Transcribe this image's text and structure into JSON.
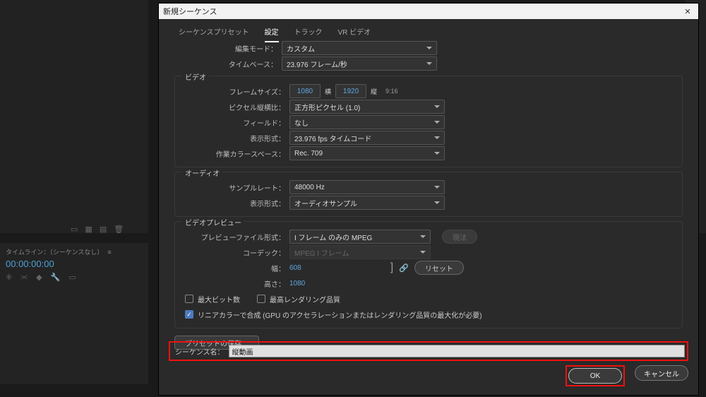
{
  "dialog": {
    "title": "新規シーケンス"
  },
  "tabs": {
    "preset": "シーケンスプリセット",
    "settings": "設定",
    "tracks": "トラック",
    "vr": "VR ビデオ"
  },
  "edit_mode": {
    "label": "編集モード：",
    "value": "カスタム"
  },
  "timebase": {
    "label": "タイムベース：",
    "value": "23.976 フレーム/秒"
  },
  "video": {
    "group": "ビデオ",
    "frame_size_label": "フレームサイズ：",
    "width": "1080",
    "w_unit": "横",
    "height": "1920",
    "h_unit": "縦",
    "ratio": "9:16",
    "pixel_aspect_label": "ピクセル縦横比：",
    "pixel_aspect": "正方形ピクセル (1.0)",
    "fields_label": "フィールド：",
    "fields": "なし",
    "display_label": "表示形式：",
    "display": "23.976 fps タイムコード",
    "color_label": "作業カラースペース：",
    "color": "Rec. 709"
  },
  "audio": {
    "group": "オーディオ",
    "rate_label": "サンプルレート：",
    "rate": "48000 Hz",
    "display_label": "表示形式：",
    "display": "オーディオサンプル"
  },
  "preview": {
    "group": "ビデオプレビュー",
    "file_label": "プレビューファイル形式：",
    "file": "I フレーム のみの MPEG",
    "build_btn": "現法",
    "codec_label": "コーデック：",
    "codec": "MPEG I フレーム",
    "width_label": "幅：",
    "width": "608",
    "height_label": "高さ：",
    "height": "1080",
    "reset_btn": "リセット",
    "max_bit": "最大ビット数",
    "max_render": "最高レンダリング品質",
    "linear": "リニアカラーで合成 (GPU のアクセラレーションまたはレンダリング品質の最大化が必要)"
  },
  "save_preset_btn": "プリセットの保存…",
  "sequence_name": {
    "label": "シーケンス名：",
    "value": "縦動画"
  },
  "footer": {
    "ok": "OK",
    "cancel": "キャンセル"
  },
  "bg": {
    "timeline_tab": "タイムライン：（シーケンスなし）",
    "timecode": "00:00:00:00"
  }
}
